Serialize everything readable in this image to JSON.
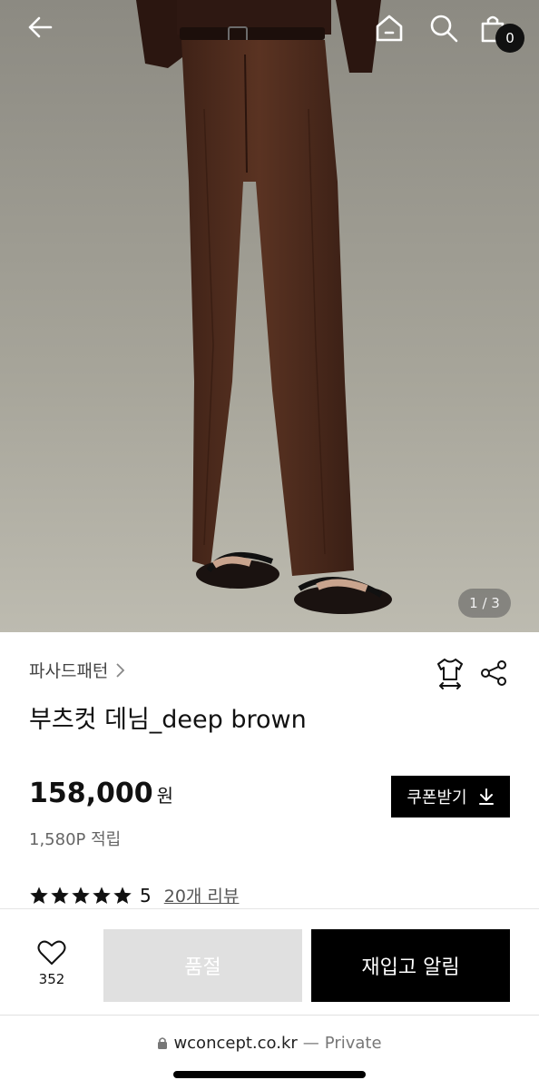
{
  "counter": {
    "text": "1 / 3"
  },
  "header": {
    "cart_count": "0"
  },
  "product": {
    "brand": "파사드패턴",
    "title": "부츠컷 데님_deep brown",
    "price": "158,000",
    "currency": "원",
    "points": "1,580P 적립",
    "coupon_label": "쿠폰받기",
    "rating_value": "5",
    "rating_fraction": 1.0,
    "review_link": "20개 리뷰"
  },
  "bottom": {
    "like_count": "352",
    "soldout_label": "품절",
    "restock_label": "재입고 알림"
  },
  "browser": {
    "domain": "wconcept.co.kr",
    "separator": "—",
    "private_label": "Private"
  },
  "colors": {
    "accent": "#000000",
    "soldout_bg": "#e0e0e0",
    "trouser": "#4e2c1e"
  },
  "icons": [
    "back-arrow-icon",
    "home-icon",
    "search-icon",
    "shopping-bag-icon",
    "chevron-right-icon",
    "size-guide-icon",
    "share-icon",
    "download-icon",
    "star-icon",
    "heart-icon",
    "lock-icon"
  ]
}
